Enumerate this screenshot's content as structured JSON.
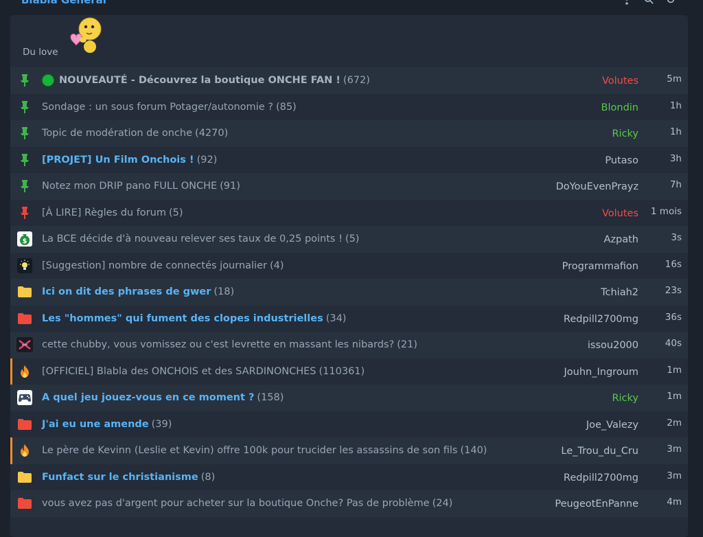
{
  "forum": {
    "title": "Blabla Général",
    "description": "Du love"
  },
  "colors": {
    "accent": "#59b3f5",
    "red_user": "#f24b4b",
    "green_user": "#5cc84a",
    "hot_bar": "#f28c28"
  },
  "header_icons": [
    "more-vertical-icon",
    "search-icon",
    "refresh-icon"
  ],
  "topics": [
    {
      "icon": "pin-green-icon",
      "prefix_dot": true,
      "title": "NOUVEAUTÉ - Découvrez la boutique ONCHE FAN !",
      "count": "(672)",
      "style": "bold-grey",
      "author": "Volutes",
      "author_color": "red",
      "time": "5m",
      "hot": false
    },
    {
      "icon": "pin-green-icon",
      "title": "Sondage : un sous forum Potager/autonomie ?",
      "count": "(85)",
      "style": "grey",
      "author": "Blondin",
      "author_color": "green",
      "time": "1h",
      "hot": false
    },
    {
      "icon": "pin-green-icon",
      "title": "Topic de modération de onche",
      "count": "(4270)",
      "style": "grey",
      "author": "Ricky",
      "author_color": "green",
      "time": "1h",
      "hot": false
    },
    {
      "icon": "pin-green-icon",
      "title": "[PROJET] Un Film Onchois !",
      "count": "(92)",
      "style": "blue",
      "author": "Putaso",
      "author_color": "normal",
      "time": "3h",
      "hot": false
    },
    {
      "icon": "pin-green-icon",
      "title": "Notez mon DRIP pano FULL ONCHE",
      "count": "(91)",
      "style": "grey",
      "author": "DoYouEvenPrayz",
      "author_color": "normal",
      "time": "7h",
      "hot": false
    },
    {
      "icon": "pin-red-icon",
      "title": "[À LIRE] Règles du forum",
      "count": "(5)",
      "style": "grey",
      "author": "Volutes",
      "author_color": "red",
      "time": "1 mois",
      "hot": false
    },
    {
      "icon": "money-bag-icon",
      "title": "La BCE décide d'à nouveau relever ses taux de 0,25 points !",
      "count": "(5)",
      "style": "grey",
      "author": "Azpath",
      "author_color": "normal",
      "time": "3s",
      "hot": false
    },
    {
      "icon": "lightbulb-icon",
      "title": "[Suggestion] nombre de connectés journalier",
      "count": "(4)",
      "style": "grey",
      "author": "Programmafion",
      "author_color": "normal",
      "time": "16s",
      "hot": false
    },
    {
      "icon": "folder-yellow-icon",
      "title": "Ici on dit des phrases de gwer",
      "count": "(18)",
      "style": "blue",
      "author": "Tchiah2",
      "author_color": "normal",
      "time": "23s",
      "hot": false
    },
    {
      "icon": "folder-red-icon",
      "title": "Les \"hommes\" qui fument des clopes industrielles",
      "count": "(34)",
      "style": "blue",
      "author": "Redpill2700mg",
      "author_color": "normal",
      "time": "36s",
      "hot": false
    },
    {
      "icon": "nsfw-icon",
      "title": "cette chubby, vous vomissez ou c'est levrette en massant les nibards?",
      "count": "(21)",
      "style": "grey",
      "author": "issou2000",
      "author_color": "normal",
      "time": "40s",
      "hot": false
    },
    {
      "icon": "fire-icon",
      "title": "[OFFICIEL] Blabla des ONCHOIS et des SARDINONCHES",
      "count": "(110361)",
      "style": "grey",
      "author": "Jouhn_Ingroum",
      "author_color": "normal",
      "time": "1m",
      "hot": true
    },
    {
      "icon": "gamepad-icon",
      "title": "A quel jeu jouez-vous en ce moment ?",
      "count": "(158)",
      "style": "blue",
      "author": "Ricky",
      "author_color": "green",
      "time": "1m",
      "hot": false
    },
    {
      "icon": "folder-red-icon",
      "title": "J'ai eu une amende",
      "count": "(39)",
      "style": "blue",
      "author": "Joe_Valezy",
      "author_color": "normal",
      "time": "2m",
      "hot": false
    },
    {
      "icon": "fire-icon",
      "title": "Le père de Kevinn (Leslie et Kevin) offre 100k pour trucider les assassins de son fils",
      "count": "(140)",
      "style": "grey",
      "author": "Le_Trou_du_Cru",
      "author_color": "normal",
      "time": "3m",
      "hot": true
    },
    {
      "icon": "folder-yellow-icon",
      "title": "Funfact sur le christianisme",
      "count": "(8)",
      "style": "blue",
      "author": "Redpill2700mg",
      "author_color": "normal",
      "time": "3m",
      "hot": false
    },
    {
      "icon": "folder-red-icon",
      "title": "vous avez pas d'argent pour acheter sur la boutique Onche? Pas de problème",
      "count": "(24)",
      "style": "grey",
      "author": "PeugeotEnPanne",
      "author_color": "normal",
      "time": "4m",
      "hot": false
    }
  ]
}
